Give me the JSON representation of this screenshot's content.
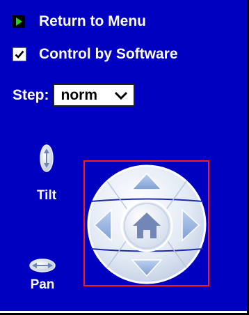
{
  "colors": {
    "panel_bg": "#0000c0",
    "text": "#ffffff",
    "bullet_green": "#22d022",
    "focus_frame": "#ff1a1a"
  },
  "menu": {
    "return_label": "Return to Menu",
    "return_icon": "green-play-bullet-icon"
  },
  "control": {
    "label": "Control by Software",
    "checked": true
  },
  "step": {
    "label": "Step:",
    "selected": "norm"
  },
  "tilt": {
    "label": "Tilt",
    "icon": "tilt-vertical-arrows-icon"
  },
  "pan": {
    "label": "Pan",
    "icon": "pan-horizontal-arrows-icon"
  },
  "pad": {
    "icons": [
      "arrow-up-icon",
      "arrow-down-icon",
      "arrow-left-icon",
      "arrow-right-icon",
      "home-icon"
    ]
  }
}
